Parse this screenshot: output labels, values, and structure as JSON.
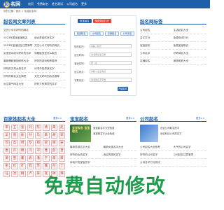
{
  "header": {
    "logo_char": "起",
    "logo_text": "名网",
    "nav": [
      "首页",
      "免费取名",
      "姓名测试",
      "公司起名",
      "更多"
    ]
  },
  "breadcrumb": "您的位置：首页 > 免费起名网",
  "left_panel": {
    "title": "起名网文章列表",
    "rows": [
      [
        "文艺小众又好听的网名",
        ""
      ],
      [
        "2023年属兔宝宝取名",
        "适合男孩的好名字"
      ],
      [
        "2023年宝宝起名注意事项",
        "文艺小众又好听的网名"
      ],
      [
        "女宝宝诗经中好听的名字",
        "双胞胎宝宝怎么取名"
      ],
      [
        "最新爆款微信昵称大全",
        "好听的游戏昵称推荐"
      ],
      [
        "好听的古风女孩名字",
        "诗词中的男孩名字"
      ],
      [
        "好听的网名女生简短",
        "文艺又好听的店名推荐"
      ],
      [
        "女生霸气网名大全",
        "好听又有寓意的名字"
      ]
    ]
  },
  "form": {
    "tab_primary": "宝宝起名",
    "tab_secondary": "免费测试打分",
    "sub_tabs": [
      "宝宝取名",
      "公司起名",
      "店铺起名",
      "公司测名"
    ],
    "fields": [
      {
        "label": "您的姓氏:",
        "placeholder": "请输入姓氏"
      },
      {
        "label": "出生时间:",
        "placeholder": "请选择出生日期"
      },
      {
        "label": "宝宝性别:",
        "placeholder": "男 / 女"
      },
      {
        "label": "出生地点:",
        "placeholder": "请输入出生地点"
      },
      {
        "label": "字数设定:",
        "placeholder": "请选择名字字数"
      }
    ],
    "submit": "开始起名"
  },
  "right_panel": {
    "title": "起名网标签",
    "rows": [
      [
        "公司起名",
        "生活起名大全"
      ],
      [
        "名字打分",
        "免费测试打分"
      ],
      [
        "宝宝起名",
        "免费宝宝取名"
      ],
      [
        "公司名字",
        "好听网名大全"
      ],
      [
        "店铺起名",
        "微信昵称大全"
      ]
    ]
  },
  "section_names": {
    "title": "百家姓起名大全",
    "more": "更多>>",
    "chars": [
      "李",
      "王",
      "张",
      "刘",
      "陈",
      "杨",
      "黄",
      "赵",
      "吴",
      "周",
      "徐",
      "孙",
      "马",
      "朱",
      "胡",
      "郭",
      "何",
      "高",
      "林",
      "罗",
      "郑",
      "梁",
      "谢",
      "宋",
      "唐",
      "许",
      "韩",
      "冯",
      "邓",
      "曹",
      "彭",
      "曾",
      "萧",
      "田",
      "董",
      "袁",
      "潘",
      "于",
      "蒋",
      "蔡",
      "余",
      "杜",
      "叶",
      "程",
      "苏",
      "魏",
      "吕",
      "丁",
      "任",
      "沈",
      "姚",
      "卢",
      "姜",
      "崔",
      "钟",
      "谭"
    ]
  },
  "section_baby": {
    "title": "宝宝起名",
    "more": "更多>>",
    "img_text": "宝宝起名 宝宝取名",
    "rows": [
      "宝宝起名字大全免费",
      "宝宝取名字大全免费",
      "最新男孩名字大全",
      "最新女孩名字大全",
      "好听的女孩名字",
      "适合男孩的名字",
      "诗经中的宝宝名字"
    ]
  },
  "section_company": {
    "title": "公司起名",
    "more": "更多>>",
    "rows": [
      "适合公司取名的字",
      "适合科技公司的名字",
      "公司起名大全参考",
      "大气的公司名字",
      "好听的公司名字",
      "公司起名注意事项",
      "公司名字打分测试"
    ]
  },
  "footer_banner": "免费自动修改"
}
